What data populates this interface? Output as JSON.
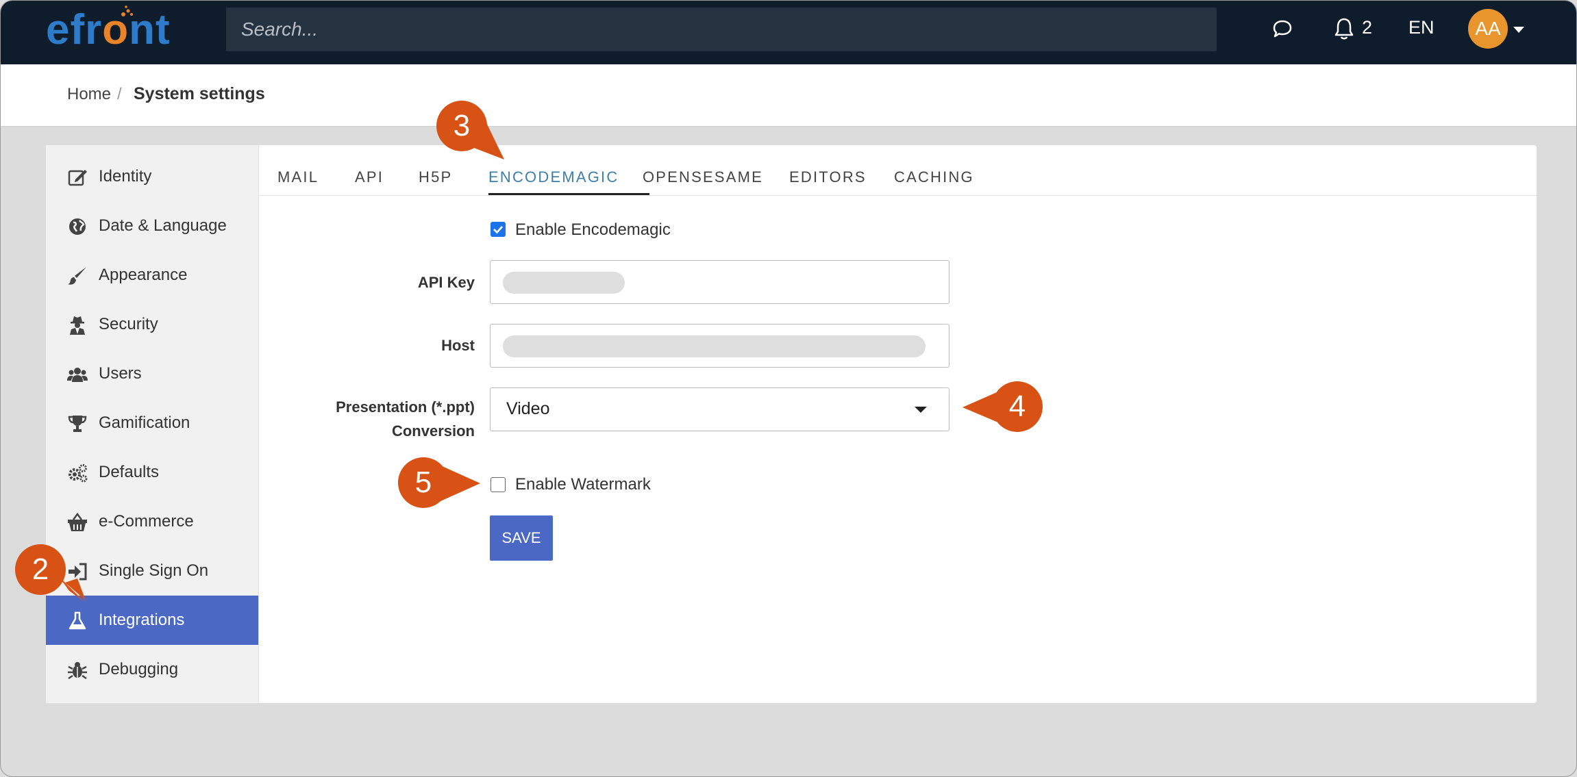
{
  "app": {
    "logo_prefix": "efr",
    "logo_o": "o",
    "logo_suffix": "nt",
    "search_placeholder": "Search...",
    "notification_count": "2",
    "language": "EN",
    "avatar_initials": "AA"
  },
  "breadcrumb": {
    "home": "Home",
    "separator": "/",
    "current": "System settings"
  },
  "sidebar": {
    "items": [
      {
        "label": "Identity",
        "icon": "edit-icon"
      },
      {
        "label": "Date & Language",
        "icon": "globe-icon"
      },
      {
        "label": "Appearance",
        "icon": "paintbrush-icon"
      },
      {
        "label": "Security",
        "icon": "user-secret-icon"
      },
      {
        "label": "Users",
        "icon": "users-icon"
      },
      {
        "label": "Gamification",
        "icon": "trophy-icon"
      },
      {
        "label": "Defaults",
        "icon": "cogs-icon"
      },
      {
        "label": "e-Commerce",
        "icon": "basket-icon"
      },
      {
        "label": "Single Sign On",
        "icon": "sign-in-icon"
      },
      {
        "label": "Integrations",
        "icon": "flask-icon",
        "active": true
      },
      {
        "label": "Debugging",
        "icon": "bug-icon"
      }
    ]
  },
  "tabs": [
    "MAIL",
    "API",
    "H5P",
    "ENCODEMAGIC",
    "OPENSESAME",
    "EDITORS",
    "CACHING"
  ],
  "active_tab": "ENCODEMAGIC",
  "form": {
    "enable_encodemagic_label": "Enable Encodemagic",
    "enable_encodemagic_checked": true,
    "api_key_label": "API Key",
    "host_label": "Host",
    "presentation_label_line1": "Presentation (*.ppt)",
    "presentation_label_line2": "Conversion",
    "presentation_value": "Video",
    "enable_watermark_label": "Enable Watermark",
    "enable_watermark_checked": false,
    "save_label": "SAVE"
  },
  "callouts": {
    "c2": "2",
    "c3": "3",
    "c4": "4",
    "c5": "5"
  },
  "colors": {
    "topbar": "#0f1c2b",
    "brand_blue": "#2e7cc9",
    "brand_orange": "#e8832a",
    "active_nav": "#4a68c4",
    "active_tab": "#3e7fa7",
    "callout": "#d75214",
    "avatar": "#e8952e"
  }
}
